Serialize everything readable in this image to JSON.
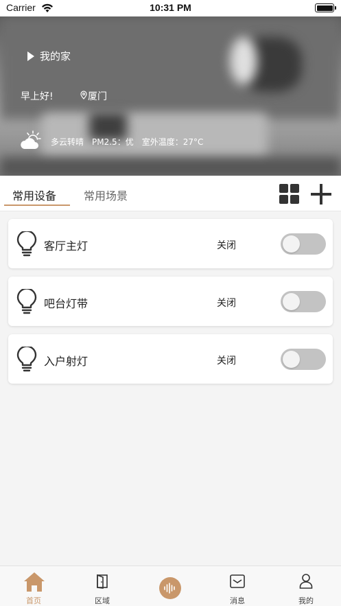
{
  "status_bar": {
    "carrier": "Carrier",
    "time": "10:31 PM"
  },
  "hero": {
    "home_name": "我的家",
    "greeting": "早上好!",
    "location": "厦门",
    "weather": {
      "icon": "partly-cloudy-icon",
      "condition": "多云转晴",
      "pm25": "PM2.5：优",
      "outdoor_temp": "室外温度：27°C"
    }
  },
  "tabs": {
    "active": "常用设备",
    "inactive": "常用场景"
  },
  "devices": [
    {
      "name": "客厅主灯",
      "state": "关闭",
      "on": false
    },
    {
      "name": "吧台灯带",
      "state": "关闭",
      "on": false
    },
    {
      "name": "入户射灯",
      "state": "关闭",
      "on": false
    }
  ],
  "bottom_nav": {
    "home": "首页",
    "region": "区域",
    "message": "消息",
    "mine": "我的"
  },
  "colors": {
    "accent": "#c9976a",
    "toggle_off": "#c3c3c3"
  }
}
